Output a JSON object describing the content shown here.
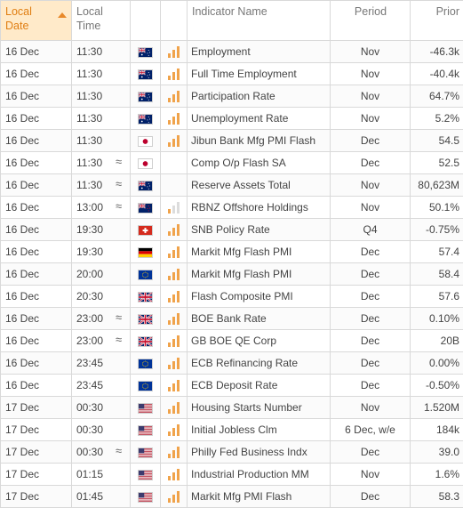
{
  "header": {
    "local_date": "Local\nDate",
    "local_time": "Local\nTime",
    "indicator_name": "Indicator Name",
    "period": "Period",
    "prior": "Prior"
  },
  "rows": [
    {
      "date": "16 Dec",
      "time": "11:30",
      "approx": false,
      "country": "AU",
      "importance": 3,
      "name": "Employment",
      "period": "Nov",
      "prior": "-46.3k"
    },
    {
      "date": "16 Dec",
      "time": "11:30",
      "approx": false,
      "country": "AU",
      "importance": 3,
      "name": "Full Time Employment",
      "period": "Nov",
      "prior": "-40.4k"
    },
    {
      "date": "16 Dec",
      "time": "11:30",
      "approx": false,
      "country": "AU",
      "importance": 3,
      "name": "Participation Rate",
      "period": "Nov",
      "prior": "64.7%"
    },
    {
      "date": "16 Dec",
      "time": "11:30",
      "approx": false,
      "country": "AU",
      "importance": 3,
      "name": "Unemployment Rate",
      "period": "Nov",
      "prior": "5.2%"
    },
    {
      "date": "16 Dec",
      "time": "11:30",
      "approx": false,
      "country": "JP",
      "importance": 3,
      "name": "Jibun Bank Mfg PMI Flash",
      "period": "Dec",
      "prior": "54.5"
    },
    {
      "date": "16 Dec",
      "time": "11:30",
      "approx": true,
      "country": "JP",
      "importance": 0,
      "name": "Comp O/p Flash SA",
      "period": "Dec",
      "prior": "52.5"
    },
    {
      "date": "16 Dec",
      "time": "11:30",
      "approx": true,
      "country": "AU",
      "importance": 0,
      "name": "Reserve Assets Total",
      "period": "Nov",
      "prior": "80,623M"
    },
    {
      "date": "16 Dec",
      "time": "13:00",
      "approx": true,
      "country": "NZ",
      "importance": 1,
      "name": "RBNZ Offshore Holdings",
      "period": "Nov",
      "prior": "50.1%"
    },
    {
      "date": "16 Dec",
      "time": "19:30",
      "approx": false,
      "country": "CH",
      "importance": 3,
      "name": "SNB Policy Rate",
      "period": "Q4",
      "prior": "-0.75%"
    },
    {
      "date": "16 Dec",
      "time": "19:30",
      "approx": false,
      "country": "DE",
      "importance": 3,
      "name": "Markit Mfg Flash PMI",
      "period": "Dec",
      "prior": "57.4"
    },
    {
      "date": "16 Dec",
      "time": "20:00",
      "approx": false,
      "country": "EU",
      "importance": 3,
      "name": "Markit Mfg Flash PMI",
      "period": "Dec",
      "prior": "58.4"
    },
    {
      "date": "16 Dec",
      "time": "20:30",
      "approx": false,
      "country": "GB",
      "importance": 3,
      "name": "Flash Composite PMI",
      "period": "Dec",
      "prior": "57.6"
    },
    {
      "date": "16 Dec",
      "time": "23:00",
      "approx": true,
      "country": "GB",
      "importance": 3,
      "name": "BOE Bank Rate",
      "period": "Dec",
      "prior": "0.10%"
    },
    {
      "date": "16 Dec",
      "time": "23:00",
      "approx": true,
      "country": "GB",
      "importance": 3,
      "name": "GB BOE QE Corp",
      "period": "Dec",
      "prior": "20B"
    },
    {
      "date": "16 Dec",
      "time": "23:45",
      "approx": false,
      "country": "EU",
      "importance": 3,
      "name": "ECB Refinancing Rate",
      "period": "Dec",
      "prior": "0.00%"
    },
    {
      "date": "16 Dec",
      "time": "23:45",
      "approx": false,
      "country": "EU",
      "importance": 3,
      "name": "ECB Deposit Rate",
      "period": "Dec",
      "prior": "-0.50%"
    },
    {
      "date": "17 Dec",
      "time": "00:30",
      "approx": false,
      "country": "US",
      "importance": 3,
      "name": "Housing Starts Number",
      "period": "Nov",
      "prior": "1.520M"
    },
    {
      "date": "17 Dec",
      "time": "00:30",
      "approx": false,
      "country": "US",
      "importance": 3,
      "name": "Initial Jobless Clm",
      "period": "6 Dec, w/e",
      "prior": "184k"
    },
    {
      "date": "17 Dec",
      "time": "00:30",
      "approx": true,
      "country": "US",
      "importance": 3,
      "name": "Philly Fed Business Indx",
      "period": "Dec",
      "prior": "39.0"
    },
    {
      "date": "17 Dec",
      "time": "01:15",
      "approx": false,
      "country": "US",
      "importance": 3,
      "name": "Industrial Production MM",
      "period": "Nov",
      "prior": "1.6%"
    },
    {
      "date": "17 Dec",
      "time": "01:45",
      "approx": false,
      "country": "US",
      "importance": 3,
      "name": "Markit Mfg PMI Flash",
      "period": "Dec",
      "prior": "58.3"
    }
  ],
  "approx_symbol": "≈",
  "colors": {
    "sort_header_bg": "#ffeac9",
    "sort_header_text": "#e07e12",
    "importance_on": "#f0a34b",
    "importance_off": "#dcdcdc"
  }
}
